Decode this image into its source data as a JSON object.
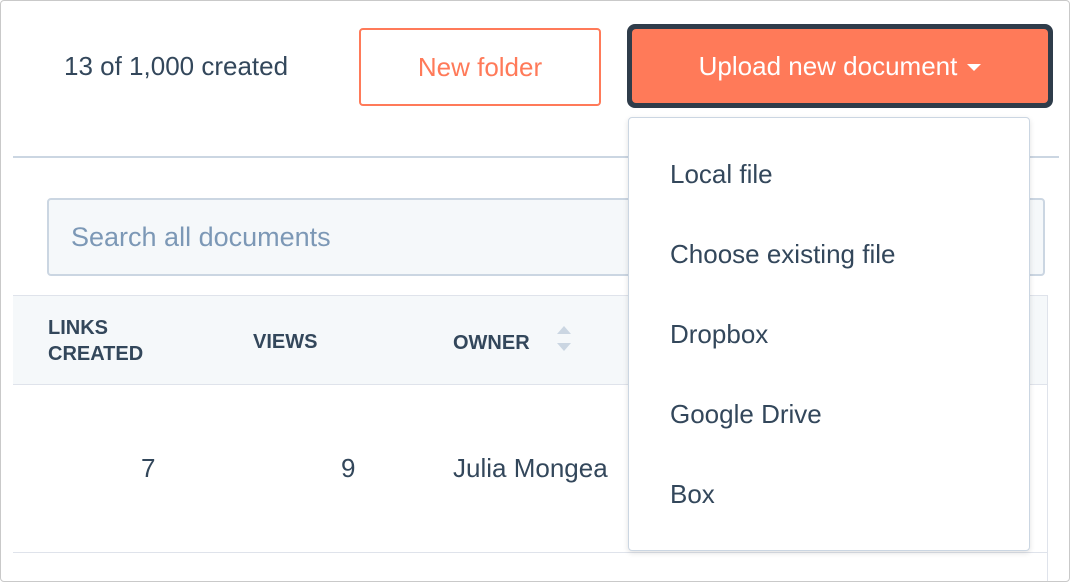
{
  "header": {
    "count_text": "13 of 1,000 created",
    "new_folder_label": "New folder",
    "upload_label": "Upload new document"
  },
  "search": {
    "placeholder": "Search all documents"
  },
  "table": {
    "columns": [
      {
        "line1": "LINKS",
        "line2": "CREATED"
      },
      {
        "label": "VIEWS"
      },
      {
        "label": "OWNER"
      }
    ],
    "rows": [
      {
        "links_created": "7",
        "views": "9",
        "owner": "Julia Mongea"
      }
    ]
  },
  "upload_menu": {
    "items": [
      "Local file",
      "Choose existing file",
      "Dropbox",
      "Google Drive",
      "Box"
    ]
  },
  "colors": {
    "accent": "#ff7a59",
    "text": "#33475b",
    "placeholder": "#7c98b6",
    "border": "#cbd6e2"
  },
  "icons": [
    "caret-down-icon",
    "sort-icon"
  ]
}
